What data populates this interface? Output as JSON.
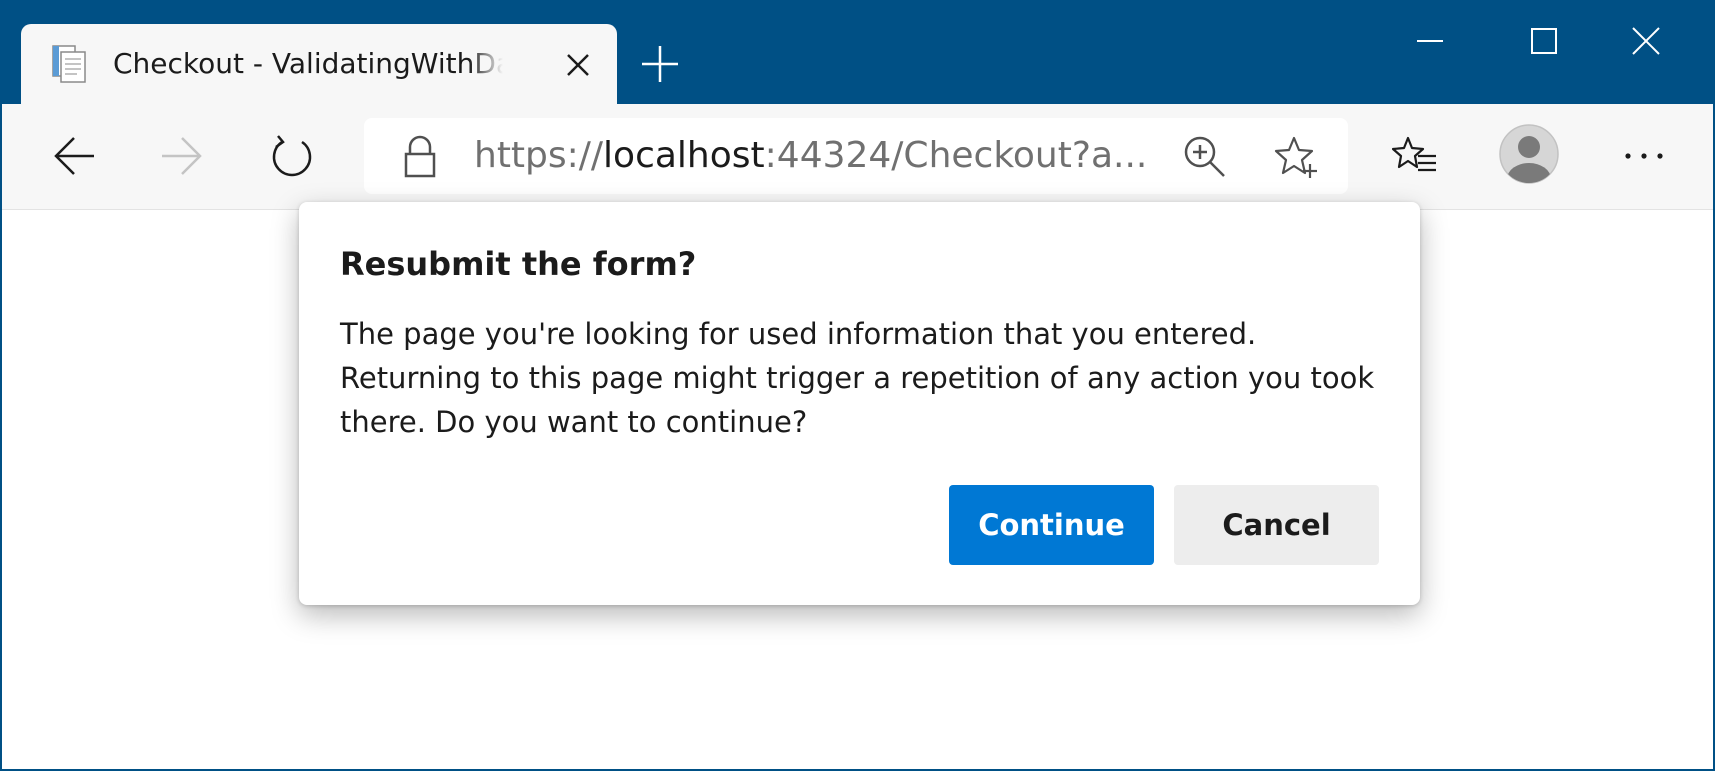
{
  "colors": {
    "frame": "#005085",
    "toolbar": "#f7f7f7",
    "primary_button": "#0078d4",
    "secondary_button": "#ededed"
  },
  "tab": {
    "title": "Checkout - ValidatingWithDataAnnotations",
    "icon": "page-icon",
    "close_icon": "close-icon"
  },
  "new_tab_icon": "plus-icon",
  "window_controls": {
    "minimize_icon": "minimize-icon",
    "maximize_icon": "maximize-icon",
    "close_icon": "close-icon"
  },
  "toolbar": {
    "back_icon": "arrow-left-icon",
    "forward_icon": "arrow-right-icon",
    "refresh_icon": "refresh-icon",
    "favorites_icon": "favorites-list-icon",
    "profile_icon": "avatar-icon",
    "more_icon": "ellipsis-icon"
  },
  "address": {
    "scheme": "https://",
    "host": "localhost",
    "rest": ":44324/Checkout?a...",
    "lock_icon": "lock-icon",
    "zoom_icon": "zoom-in-icon",
    "star_icon": "star-add-icon"
  },
  "dialog": {
    "title": "Resubmit the form?",
    "message": "The page you're looking for used information that you entered. Returning to this page might trigger a repetition of any action you took there. Do you want to continue?",
    "continue_label": "Continue",
    "cancel_label": "Cancel"
  }
}
